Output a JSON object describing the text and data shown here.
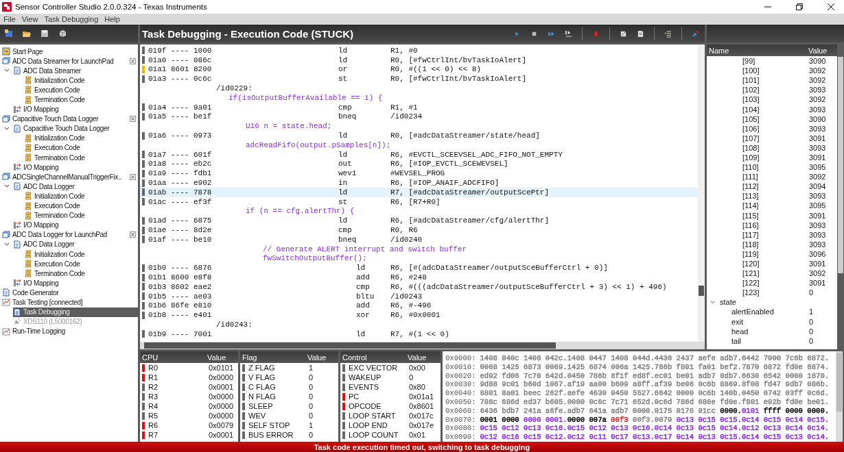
{
  "window": {
    "title": "Sensor Controller Studio 2.0.0.324 - Texas Instruments"
  },
  "menu": [
    "File",
    "View",
    "Task Debugging",
    "Help"
  ],
  "sidebar": {
    "items": [
      {
        "label": "Start Page",
        "kind": "start",
        "selected": false
      },
      {
        "label": "ADC Data Streamer for LaunchPad",
        "kind": "project",
        "selected": false,
        "children": [
          {
            "label": "ADC Data Streamer",
            "kind": "task",
            "expanded": true,
            "selected": false,
            "children": [
              {
                "label": "Initialization Code",
                "kind": "code",
                "selected": false
              },
              {
                "label": "Execution Code",
                "kind": "code",
                "selected": false
              },
              {
                "label": "Termination Code",
                "kind": "code",
                "selected": false
              }
            ]
          },
          {
            "label": "I/O Mapping",
            "kind": "io",
            "selected": false
          }
        ]
      },
      {
        "label": "Capacitive Touch Data Logger",
        "kind": "project",
        "selected": false,
        "children": [
          {
            "label": "Capacitive Touch Data Logger",
            "kind": "task",
            "expanded": true,
            "selected": false,
            "children": [
              {
                "label": "Initialization Code",
                "kind": "code",
                "selected": false
              },
              {
                "label": "Execution Code",
                "kind": "code",
                "selected": false
              },
              {
                "label": "Termination Code",
                "kind": "code",
                "selected": false
              }
            ]
          },
          {
            "label": "I/O Mapping",
            "kind": "io",
            "selected": false
          }
        ]
      },
      {
        "label": "ADCSingleChannelManualTriggerFix..",
        "kind": "project",
        "selected": false,
        "children": [
          {
            "label": "ADC Data Logger",
            "kind": "task",
            "expanded": true,
            "selected": false,
            "children": [
              {
                "label": "Initialization Code",
                "kind": "code",
                "selected": false
              },
              {
                "label": "Execution Code",
                "kind": "code",
                "selected": false
              },
              {
                "label": "Termination Code",
                "kind": "code",
                "selected": false
              }
            ]
          },
          {
            "label": "I/O Mapping",
            "kind": "io",
            "selected": false
          }
        ]
      },
      {
        "label": "ADC Data Logger for LaunchPad",
        "kind": "project",
        "selected": false,
        "children": [
          {
            "label": "ADC Data Logger",
            "kind": "task",
            "expanded": true,
            "selected": false,
            "children": [
              {
                "label": "Initialization Code",
                "kind": "code",
                "selected": false
              },
              {
                "label": "Execution Code",
                "kind": "code",
                "selected": false
              },
              {
                "label": "Termination Code",
                "kind": "code",
                "selected": false
              }
            ]
          },
          {
            "label": "I/O Mapping",
            "kind": "io",
            "selected": false
          }
        ]
      },
      {
        "label": "Code Generator",
        "kind": "generator",
        "selected": false
      },
      {
        "label": "Task Testing [connected]",
        "kind": "testing",
        "selected": false,
        "children": [
          {
            "label": "Task Debugging",
            "kind": "debug",
            "selected": true
          },
          {
            "label": "XDS110 (L5000162)",
            "kind": "device",
            "selected": false
          }
        ]
      },
      {
        "label": "Run-Time Logging",
        "kind": "logging",
        "selected": false
      }
    ]
  },
  "editor": {
    "title": "Task Debugging - Execution Code (STUCK)",
    "lines": [
      {
        "kind": "asm",
        "address": "019f ---- 1000",
        "mnemonic": "ld",
        "operands": "R1, #0",
        "current": false,
        "selected": false
      },
      {
        "kind": "asm",
        "address": "01a0 ---- 086c",
        "mnemonic": "ld",
        "operands": "R0, [#fwCtrlInt/bvTaskIoAlert]",
        "current": false,
        "selected": false
      },
      {
        "kind": "asm",
        "address": "01a1 8601 8200",
        "mnemonic": "or",
        "operands": "R0, #((1 << 0) << 8)",
        "current": true,
        "selected": false
      },
      {
        "kind": "asm",
        "address": "01a3 ---- 0c6c",
        "mnemonic": "st",
        "operands": "R0, [#fwCtrlInt/bvTaskIoAlert]",
        "current": false,
        "selected": false
      },
      {
        "kind": "label",
        "text": "/id0229:"
      },
      {
        "kind": "source",
        "text": "if(isOutputBufferAvailable == 1) {",
        "children": [
          {
            "kind": "asm",
            "address": "01a4 ---- 9a01",
            "mnemonic": "cmp",
            "operands": "R1, #1",
            "current": false,
            "selected": false
          },
          {
            "kind": "asm",
            "address": "01a5 ---- be1f",
            "mnemonic": "bneq",
            "operands": "/id0234",
            "current": false,
            "selected": false
          },
          {
            "kind": "source",
            "text": "U16 n = state.head;",
            "children": [
              {
                "kind": "asm",
                "address": "01a6 ---- 0973",
                "mnemonic": "ld",
                "operands": "R0, [#adcDataStreamer/state/head]",
                "current": false,
                "selected": false
              }
            ]
          },
          {
            "kind": "source",
            "text": "adcReadFifo(output.pSamples[n]);",
            "children": [
              {
                "kind": "asm",
                "address": "01a7 ---- 601f",
                "mnemonic": "ld",
                "operands": "R6, #EVCTL_SCEEVSEL_ADC_FIFO_NOT_EMPTY",
                "current": false,
                "selected": false
              },
              {
                "kind": "asm",
                "address": "01a8 ---- eb2c",
                "mnemonic": "out",
                "operands": "R6, [#IOP_EVCTL_SCEWEVSEL]",
                "current": false,
                "selected": false
              },
              {
                "kind": "asm",
                "address": "01a9 ---- fdb1",
                "mnemonic": "wev1",
                "operands": "#WEVSEL_PROG",
                "current": false,
                "selected": false
              },
              {
                "kind": "asm",
                "address": "01aa ---- e902",
                "mnemonic": "in",
                "operands": "R6, [#IOP_ANAIF_ADCFIFO]",
                "current": false,
                "selected": false
              },
              {
                "kind": "asm",
                "address": "01ab ---- 7878",
                "mnemonic": "ld",
                "operands": "R7, [#adcDataStreamer/outputScePtr]",
                "current": false,
                "selected": true
              },
              {
                "kind": "asm",
                "address": "01ac ---- ef3f",
                "mnemonic": "st",
                "operands": "R6, [R7+R0]",
                "current": false,
                "selected": false
              }
            ]
          },
          {
            "kind": "source",
            "text": "if (n == cfg.alertThr) {",
            "children": [
              {
                "kind": "asm",
                "address": "01ad ---- 6875",
                "mnemonic": "ld",
                "operands": "R6, [#adcDataStreamer/cfg/alertThr]",
                "current": false,
                "selected": false
              },
              {
                "kind": "asm",
                "address": "01ae ---- 8d2e",
                "mnemonic": "cmp",
                "operands": "R0, R6",
                "current": false,
                "selected": false
              },
              {
                "kind": "asm",
                "address": "01af ---- be10",
                "mnemonic": "bneq",
                "operands": "/id0240",
                "current": false,
                "selected": false
              },
              {
                "kind": "source",
                "text": "// Generate ALERT interrupt and switch buffer"
              },
              {
                "kind": "source",
                "text": "fwSwitchOutputBuffer();",
                "children": [
                  {
                    "kind": "asm",
                    "address": "01b0 ---- 6876",
                    "mnemonic": "ld",
                    "operands": "R6, [#(adcDataStreamer/outputSceBufferCtrl + 0)]",
                    "current": false,
                    "selected": false
                  },
                  {
                    "kind": "asm",
                    "address": "01b1 8600 e8f8",
                    "mnemonic": "add",
                    "operands": "R6, #248",
                    "current": false,
                    "selected": false
                  },
                  {
                    "kind": "asm",
                    "address": "01b3 8602 eae2",
                    "mnemonic": "cmp",
                    "operands": "R6, #(((adcDataStreamer/outputSceBufferCtrl + 3) << 1) + 496)",
                    "current": false,
                    "selected": false
                  },
                  {
                    "kind": "asm",
                    "address": "01b5 ---- ae03",
                    "mnemonic": "bltu",
                    "operands": "/id0243",
                    "current": false,
                    "selected": false
                  },
                  {
                    "kind": "asm",
                    "address": "01b6 86fe e810",
                    "mnemonic": "add",
                    "operands": "R6, #-496",
                    "current": false,
                    "selected": false
                  },
                  {
                    "kind": "asm",
                    "address": "01b8 ---- e401",
                    "mnemonic": "xor",
                    "operands": "R6, #0x0001",
                    "current": false,
                    "selected": false
                  },
                  {
                    "kind": "label",
                    "text": "/id0243:"
                  },
                  {
                    "kind": "asm",
                    "address": "01b9 ---- 7001",
                    "mnemonic": "ld",
                    "operands": "R7, #(1 << 0)",
                    "current": false,
                    "selected": false
                  }
                ]
              }
            ]
          }
        ]
      }
    ]
  },
  "variables": {
    "columns": [
      "Name",
      "Value"
    ],
    "rows": [
      {
        "name": "[99]",
        "value": "3090",
        "kind": "element"
      },
      {
        "name": "[100]",
        "value": "3092",
        "kind": "element"
      },
      {
        "name": "[101]",
        "value": "3092",
        "kind": "element"
      },
      {
        "name": "[102]",
        "value": "3093",
        "kind": "element"
      },
      {
        "name": "[103]",
        "value": "3092",
        "kind": "element"
      },
      {
        "name": "[104]",
        "value": "3093",
        "kind": "element"
      },
      {
        "name": "[105]",
        "value": "3090",
        "kind": "element"
      },
      {
        "name": "[106]",
        "value": "3093",
        "kind": "element"
      },
      {
        "name": "[107]",
        "value": "3091",
        "kind": "element"
      },
      {
        "name": "[108]",
        "value": "3093",
        "kind": "element"
      },
      {
        "name": "[109]",
        "value": "3091",
        "kind": "element"
      },
      {
        "name": "[110]",
        "value": "3095",
        "kind": "element"
      },
      {
        "name": "[111]",
        "value": "3092",
        "kind": "element"
      },
      {
        "name": "[112]",
        "value": "3094",
        "kind": "element"
      },
      {
        "name": "[113]",
        "value": "3093",
        "kind": "element"
      },
      {
        "name": "[114]",
        "value": "3095",
        "kind": "element"
      },
      {
        "name": "[115]",
        "value": "3091",
        "kind": "element"
      },
      {
        "name": "[116]",
        "value": "3093",
        "kind": "element"
      },
      {
        "name": "[117]",
        "value": "3093",
        "kind": "element"
      },
      {
        "name": "[118]",
        "value": "3093",
        "kind": "element"
      },
      {
        "name": "[119]",
        "value": "3096",
        "kind": "element"
      },
      {
        "name": "[120]",
        "value": "3091",
        "kind": "element"
      },
      {
        "name": "[121]",
        "value": "3092",
        "kind": "element"
      },
      {
        "name": "[122]",
        "value": "3091",
        "kind": "element"
      },
      {
        "name": "[123]",
        "value": "0",
        "kind": "element"
      },
      {
        "name": "state",
        "kind": "struct",
        "expanded": true,
        "children": [
          {
            "name": "alertEnabled",
            "value": "1",
            "kind": "field"
          },
          {
            "name": "exit",
            "value": "0",
            "kind": "field"
          },
          {
            "name": "head",
            "value": "0",
            "kind": "field"
          },
          {
            "name": "tail",
            "value": "0",
            "kind": "field"
          }
        ]
      }
    ]
  },
  "registers": [
    {
      "title": "CPU",
      "value_heading": "Value",
      "rows": [
        {
          "name": "R0",
          "value": "0x0101",
          "changed": true
        },
        {
          "name": "R1",
          "value": "0x0000",
          "changed": true
        },
        {
          "name": "R2",
          "value": "0x0001",
          "changed": false
        },
        {
          "name": "R3",
          "value": "0x0000",
          "changed": false
        },
        {
          "name": "R4",
          "value": "0x0000",
          "changed": false
        },
        {
          "name": "R5",
          "value": "0x0000",
          "changed": false
        },
        {
          "name": "R6",
          "value": "0x0079",
          "changed": true
        },
        {
          "name": "R7",
          "value": "0x0001",
          "changed": true
        }
      ]
    },
    {
      "title": "Flag",
      "value_heading": "Value",
      "rows": [
        {
          "name": "Z FLAG",
          "value": "1",
          "changed": false
        },
        {
          "name": "V FLAG",
          "value": "0",
          "changed": false
        },
        {
          "name": "C FLAG",
          "value": "0",
          "changed": false
        },
        {
          "name": "N FLAG",
          "value": "0",
          "changed": false
        },
        {
          "name": "SLEEP",
          "value": "0",
          "changed": false
        },
        {
          "name": "WEV",
          "value": "0",
          "changed": false
        },
        {
          "name": "SELF STOP",
          "value": "1",
          "changed": false
        },
        {
          "name": "BUS ERROR",
          "value": "0",
          "changed": false
        }
      ]
    },
    {
      "title": "Control",
      "value_heading": "Value",
      "rows": [
        {
          "name": "EXC VECTOR",
          "value": "0x00",
          "changed": false
        },
        {
          "name": "WAKEUP",
          "value": "0",
          "changed": false
        },
        {
          "name": "EVENTS",
          "value": "0x80",
          "changed": false
        },
        {
          "name": "PC",
          "value": "0x01a1",
          "changed": true
        },
        {
          "name": "OPCODE",
          "value": "0x8601",
          "changed": true
        },
        {
          "name": "LOOP START",
          "value": "0x017c",
          "changed": false
        },
        {
          "name": "LOOP END",
          "value": "0x017e",
          "changed": false
        },
        {
          "name": "LOOP COUNT",
          "value": "0x01",
          "changed": false
        }
      ]
    }
  ],
  "memory": [
    {
      "address": "0x0000:",
      "segments": [
        {
          "text": "1408 040c 1408 042c.1408 0447 1408 044d.4436 2437 aefe adb7.6442 7000 7c6b 6872.",
          "color": "#808080"
        }
      ]
    },
    {
      "address": "0x0010:",
      "segments": [
        {
          "text": "0068 1425 6873 0069.1425 6874 006a 1425.786b f801 fa01 bef2.7870 6872 fd0e 6874.",
          "color": "#808080"
        }
      ]
    },
    {
      "address": "0x0020:",
      "segments": [
        {
          "text": "ed92 fd06 7c70 642d.0450 786b 8f1f ed8f.ec01 be01 adb7 8db7.6630 6542 0000 1870.",
          "color": "#808080"
        }
      ]
    },
    {
      "address": "0x0030:",
      "segments": [
        {
          "text": "9d88 9c01 b60d 1067.af19 aa00 b609 a8ff.af39 be06 0c6b 8869.8f08 fd47 9db7 086b.",
          "color": "#808080"
        }
      ]
    },
    {
      "address": "0x0040:",
      "segments": [
        {
          "text": "8801 8a01 beec 262f.aefe 4630 0450 5527.6642 0000 0c6b 140b.0450 6742 03ff 0c6d.",
          "color": "#808080"
        }
      ]
    },
    {
      "address": "0x0050:",
      "segments": [
        {
          "text": "786c 686d ed37 b605.0000 0c6c 7c71 652d.0c6d 786d 686e fd0e.f801 e92b fd0e be01.",
          "color": "#808080"
        }
      ]
    },
    {
      "address": "0x0060:",
      "segments": [
        {
          "text": "6436 bdb7 241a a6fe.adb7 641a adb7 0000.0175 0176 01cc ",
          "color": "#808080"
        },
        {
          "text": "0000.",
          "color": "#000000"
        },
        {
          "text": "0101 ",
          "color": "#8a2be2"
        },
        {
          "text": "ffff 0000 0000.",
          "color": "#000000"
        }
      ]
    },
    {
      "address": "0x0070:",
      "segments": [
        {
          "text": "0001 0000 ",
          "color": "#000000"
        },
        {
          "text": "0000 0001.",
          "color": "#8a2be2"
        },
        {
          "text": "0000 007a ",
          "color": "#000000"
        },
        {
          "text": "00f3 ",
          "color": "#e02020"
        },
        {
          "text": "00f3.0079 ",
          "color": "#808080"
        },
        {
          "text": "0c13 0c15 0c15.0c14 0c15 0c14 0c15.",
          "color": "#8a2be2"
        }
      ]
    },
    {
      "address": "0x0080:",
      "segments": [
        {
          "text": "0c15 0c12 0c13 0c16.0c15 0c12 0c13 0c16.0c14 0c13 0c15 0c14.0c12 0c13 0c14 0c14.",
          "color": "#8a2be2"
        }
      ]
    },
    {
      "address": "0x0090:",
      "segments": [
        {
          "text": "0c12 0c16 0c15 0c12.0c12 0c11 0c17 0c13.0c17 0c14 0c13 0c15.0c14 0c15 0c13 0c14.",
          "color": "#8a2be2"
        }
      ]
    }
  ],
  "status_bar": "Task code execution timed out, switching to task debugging"
}
